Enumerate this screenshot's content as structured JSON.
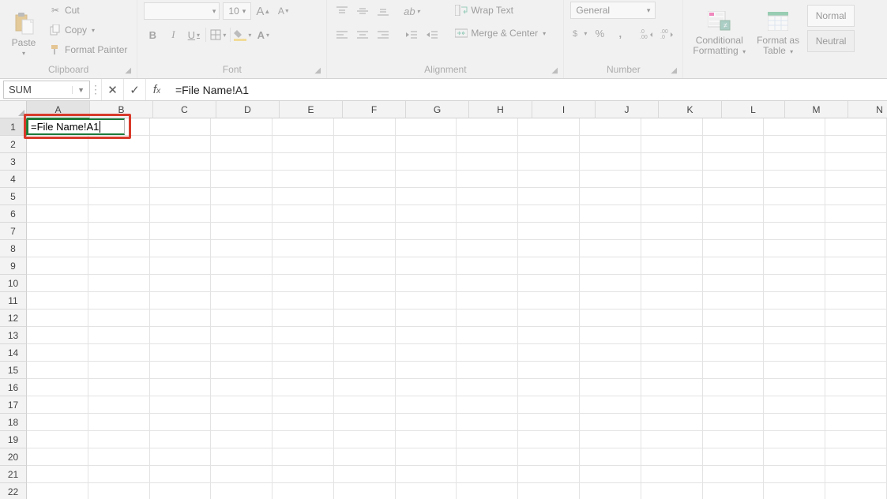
{
  "ribbon": {
    "clipboard": {
      "paste_label": "Paste",
      "cut_label": "Cut",
      "copy_label": "Copy",
      "format_painter_label": "Format Painter",
      "group_label": "Clipboard"
    },
    "font": {
      "font_name": "",
      "font_size": "10",
      "group_label": "Font"
    },
    "alignment": {
      "wrap_label": "Wrap Text",
      "merge_label": "Merge & Center",
      "group_label": "Alignment"
    },
    "number": {
      "format_value": "General",
      "group_label": "Number"
    },
    "styles": {
      "conditional_label_l1": "Conditional",
      "conditional_label_l2": "Formatting",
      "formatas_label_l1": "Format as",
      "formatas_label_l2": "Table",
      "normal_label": "Normal",
      "neutral_label": "Neutral"
    }
  },
  "formula_bar": {
    "name_box": "SUM",
    "formula_text": "=File Name!A1"
  },
  "grid": {
    "columns": [
      "A",
      "B",
      "C",
      "D",
      "E",
      "F",
      "G",
      "H",
      "I",
      "J",
      "K",
      "L",
      "M",
      "N"
    ],
    "rows": [
      1,
      2,
      3,
      4,
      5,
      6,
      7,
      8,
      9,
      10,
      11,
      12,
      13,
      14,
      15,
      16,
      17,
      18,
      19,
      20,
      21,
      22
    ],
    "active_cell": "A1",
    "cell_edit_text": "=File Name!A1"
  }
}
